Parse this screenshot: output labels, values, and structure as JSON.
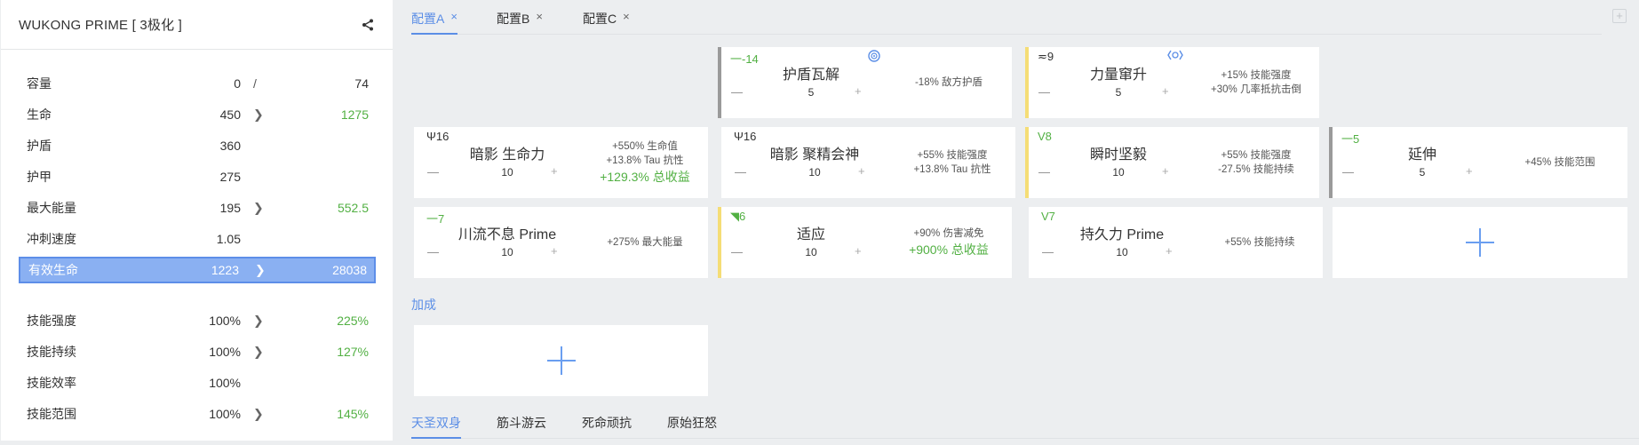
{
  "warframe": {
    "title": "WUKONG PRIME [ 3极化 ]"
  },
  "stats": [
    {
      "label": "容量",
      "base": "0",
      "sep": "/",
      "mod": "74",
      "mod_plain": true
    },
    {
      "label": "生命",
      "base": "450",
      "arrow": true,
      "mod": "1275"
    },
    {
      "label": "护盾",
      "base": "360"
    },
    {
      "label": "护甲",
      "base": "275"
    },
    {
      "label": "最大能量",
      "base": "195",
      "arrow": true,
      "mod": "552.5"
    },
    {
      "label": "冲刺速度",
      "base": "1.05"
    },
    {
      "label": "有效生命",
      "base": "1223",
      "arrow": true,
      "mod": "28038",
      "highlight": true
    }
  ],
  "stats2": [
    {
      "label": "技能强度",
      "base": "100%",
      "arrow": true,
      "mod": "225%"
    },
    {
      "label": "技能持续",
      "base": "100%",
      "arrow": true,
      "mod": "127%"
    },
    {
      "label": "技能效率",
      "base": "100%"
    },
    {
      "label": "技能范围",
      "base": "100%",
      "arrow": true,
      "mod": "145%"
    }
  ],
  "config_tabs": [
    {
      "label": "配置A",
      "close": "×"
    },
    {
      "label": "配置B",
      "close": "×"
    },
    {
      "label": "配置C",
      "close": "×"
    }
  ],
  "add_tab": "+",
  "mods": {
    "aura": {
      "polarity": "一-14",
      "name": "护盾瓦解",
      "rank": "5",
      "effects": [
        "-18% 敌方护盾"
      ],
      "minus": "—",
      "plus": "+"
    },
    "exilus": {
      "polarity": "≂9",
      "name": "力量窜升",
      "rank": "5",
      "effects": [
        "+15% 技能强度",
        "+30% 几率抵抗击倒"
      ],
      "minus": "—",
      "plus": "+"
    },
    "slots": [
      {
        "polarity": "Ψ16",
        "name": "暗影 生命力",
        "rank": "10",
        "effects": [
          "+550% 生命值",
          "+13.8% Tau 抗性"
        ],
        "total": "+129.3% 总收益",
        "minus": "—",
        "plus": "+"
      },
      {
        "polarity": "Ψ16",
        "name": "暗影 聚精会神",
        "rank": "10",
        "effects": [
          "+55% 技能强度",
          "+13.8% Tau 抗性"
        ],
        "minus": "—",
        "plus": "+"
      },
      {
        "polarity": "V8",
        "name": "瞬时坚毅",
        "rank": "10",
        "effects": [
          "+55% 技能强度",
          "-27.5% 技能持续"
        ],
        "minus": "—",
        "plus": "+"
      },
      {
        "polarity": "一5",
        "name": "延伸",
        "rank": "5",
        "effects": [
          "+45% 技能范围"
        ],
        "minus": "—",
        "plus": "+"
      },
      {
        "polarity": "一7",
        "name": "川流不息 Prime",
        "rank": "10",
        "effects": [
          "+275% 最大能量"
        ],
        "minus": "—",
        "plus": "+"
      },
      {
        "polarity": "◥6",
        "name": "适应",
        "rank": "10",
        "effects": [
          "+90% 伤害减免"
        ],
        "total": "+900% 总收益",
        "minus": "—",
        "plus": "+"
      },
      {
        "polarity": "V7",
        "name": "持久力 Prime",
        "rank": "10",
        "effects": [
          "+55% 技能持续"
        ],
        "minus": "—",
        "plus": "+"
      }
    ]
  },
  "bonus_label": "加成",
  "ability_tabs": [
    "天圣双身",
    "筋斗游云",
    "死命顽抗",
    "原始狂怒"
  ],
  "colors": {
    "accent": "#5b8ee6",
    "positive": "#52b043",
    "highlight": "#8ab0f2",
    "umbra_gray": "#9a9a9a",
    "gold": "#f5dd76"
  }
}
